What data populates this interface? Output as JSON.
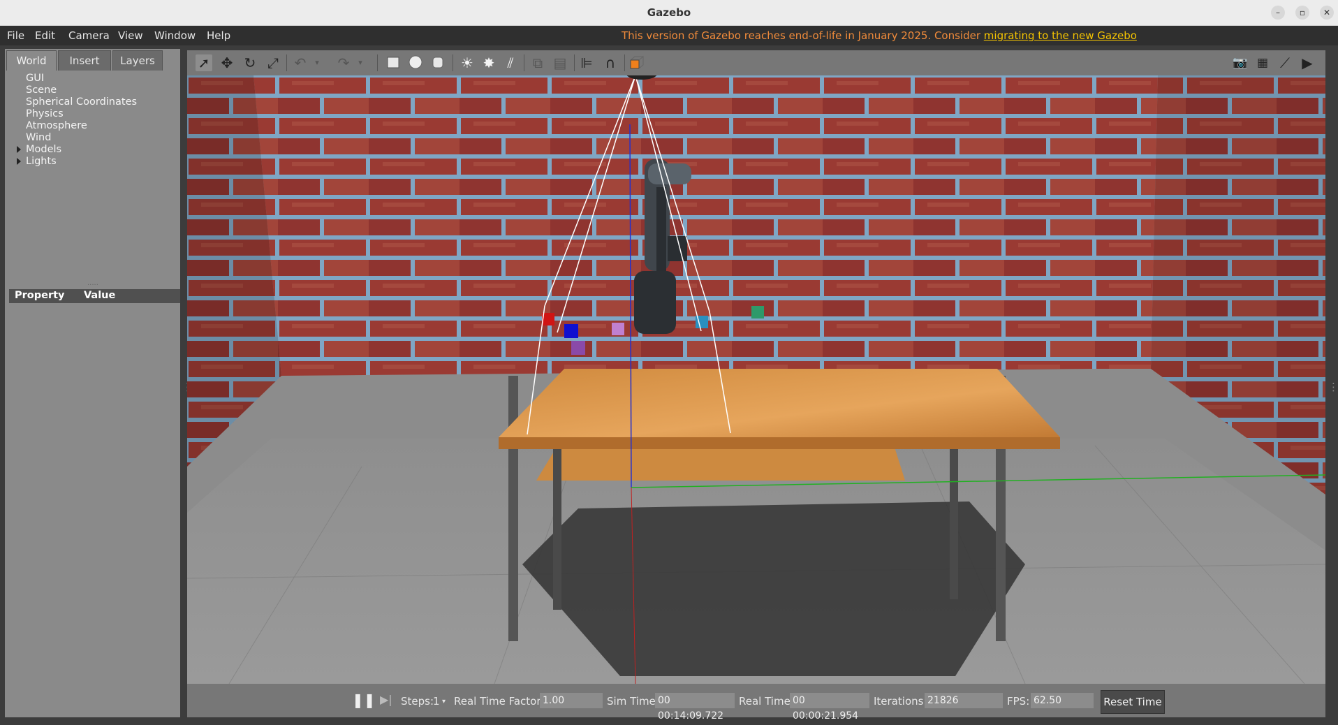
{
  "window": {
    "title": "Gazebo"
  },
  "menu": {
    "items": [
      "File",
      "Edit",
      "Camera",
      "View",
      "Window",
      "Help"
    ],
    "notice_text": "This version of Gazebo reaches end-of-life in January 2025. Consider ",
    "notice_link": "migrating to the new Gazebo"
  },
  "left_panel": {
    "tabs": [
      "World",
      "Insert",
      "Layers"
    ],
    "active_tab": "World",
    "tree": [
      "GUI",
      "Scene",
      "Spherical Coordinates",
      "Physics",
      "Atmosphere",
      "Wind",
      "Models",
      "Lights"
    ],
    "property_header": "Property",
    "value_header": "Value"
  },
  "toolbar": {
    "tools": [
      "select-mode",
      "translate-mode",
      "rotate-mode",
      "scale-mode",
      "undo",
      "redo",
      "box",
      "sphere",
      "cylinder",
      "point-light",
      "spot-light",
      "directional-light",
      "copy",
      "paste",
      "align",
      "snap",
      "change-view"
    ],
    "right_tools": [
      "screenshot",
      "log",
      "plot",
      "record-video"
    ]
  },
  "status": {
    "steps_label": "Steps:",
    "steps_value": "1",
    "rtf_label": "Real Time Factor:",
    "rtf_value": "1.00",
    "sim_time_label": "Sim Time:",
    "sim_time_value": "00 00:14:09.722",
    "real_time_label": "Real Time:",
    "real_time_value": "00 00:00:21.954",
    "iterations_label": "Iterations:",
    "iterations_value": "21826",
    "fps_label": "FPS:",
    "fps_value": "62.50",
    "reset_label": "Reset Time"
  },
  "scene": {
    "cube_colors": [
      "#d01414",
      "#1010d0",
      "#8a4aa8",
      "#c080d0",
      "#2a8fbf",
      "#2e9a6a"
    ]
  }
}
